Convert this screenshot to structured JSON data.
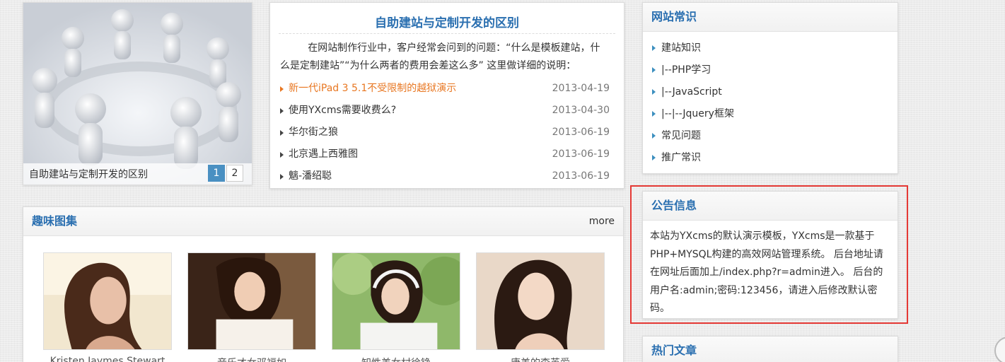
{
  "slider": {
    "caption": "自助建站与定制开发的区别",
    "pages": [
      "1",
      "2"
    ]
  },
  "article": {
    "title": "自助建站与定制开发的区别",
    "intro": "在网站制作行业中，客户经常会问到的问题：“什么是模板建站，什么是定制建站”“为什么两者的费用会差这么多” 这里做详细的说明：",
    "items": [
      {
        "title": "新一代iPad 3 5.1不受限制的越狱演示",
        "date": "2013-04-19"
      },
      {
        "title": "使用YXcms需要收费么?",
        "date": "2013-04-30"
      },
      {
        "title": "华尔街之狼",
        "date": "2013-06-19"
      },
      {
        "title": "北京遇上西雅图",
        "date": "2013-06-19"
      },
      {
        "title": "魑-潘绍聪",
        "date": "2013-06-19"
      }
    ]
  },
  "gallery": {
    "title": "趣味图集",
    "more": "more",
    "photos": [
      {
        "caption": "Kristen Jaymes Stewart"
      },
      {
        "caption": "音乐才女邓福如"
      },
      {
        "caption": "知性美女村徐铮"
      },
      {
        "caption": "唐美的李英爱"
      }
    ]
  },
  "knowledge": {
    "title": "网站常识",
    "items": [
      "建站知识",
      "|--PHP学习",
      "|--JavaScript",
      "|--|--Jquery框架",
      "常见问题",
      "推广常识"
    ]
  },
  "notice": {
    "title": "公告信息",
    "text": "本站为YXcms的默认演示模板，YXcms是一款基于PHP+MYSQL构建的高效网站管理系统。 后台地址请在网址后面加上/index.php?r=admin进入。 后台的用户名:admin;密码:123456，请进入后修改默认密码。"
  },
  "hot": {
    "title": "热门文章"
  },
  "colors": {
    "accent_blue": "#2a6fb0",
    "highlight_orange": "#e87722",
    "pager_active": "#4a90c2",
    "annotation_red": "#e53935"
  }
}
